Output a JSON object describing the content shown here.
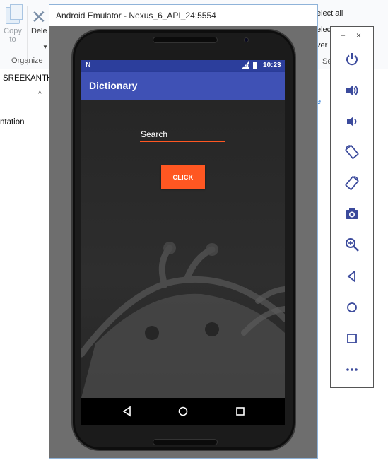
{
  "explorer": {
    "copy_label": "Copy",
    "copy_to_label": "to",
    "delete_label": "Dele",
    "organize_label": "Organize",
    "select_all_label": "elect all",
    "select_none_label": "elect",
    "invert_label": "ver",
    "select_group_label": "Se",
    "address_text": "SREEKANTH",
    "nav_item_label": "ntation",
    "right_text": "e"
  },
  "emulator": {
    "title": "Android Emulator - Nexus_6_API_24:5554"
  },
  "phone": {
    "status": {
      "notification": "N",
      "network": "LTE",
      "time": "10:23"
    },
    "app_title": "Dictionary",
    "search": {
      "placeholder": "Search",
      "value": ""
    },
    "click_label": "CLICK"
  },
  "toolbar": {
    "minimize_label": "–",
    "close_label": "×",
    "buttons": [
      "power-icon",
      "volume-up-icon",
      "volume-down-icon",
      "rotate-left-icon",
      "rotate-right-icon",
      "camera-icon",
      "zoom-icon",
      "back-icon",
      "home-icon",
      "overview-icon",
      "more-icon"
    ]
  },
  "colors": {
    "app_bar": "#3f51b5",
    "status_bar": "#2c3e9c",
    "accent": "#ff5722",
    "toolbar_icon": "#3b4a9c"
  }
}
